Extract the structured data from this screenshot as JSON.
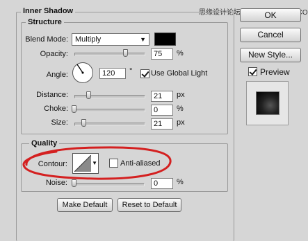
{
  "panel": {
    "title": "Inner Shadow"
  },
  "watermark": "思缘设计论坛 www.MISSYUAN.COM",
  "structure": {
    "title": "Structure",
    "blend_mode": {
      "label": "Blend Mode:",
      "value": "Multiply",
      "color": "#000000"
    },
    "opacity": {
      "label": "Opacity:",
      "value": "75",
      "unit": "%",
      "slider_fraction": 0.75
    },
    "angle": {
      "label": "Angle:",
      "value": "120",
      "unit": "°",
      "degrees": 120
    },
    "use_global_light": {
      "label": "Use Global Light",
      "checked": true
    },
    "distance": {
      "label": "Distance:",
      "value": "21",
      "unit": "px",
      "slider_fraction": 0.1
    },
    "choke": {
      "label": "Choke:",
      "value": "0",
      "unit": "%",
      "slider_fraction": 0.0
    },
    "size": {
      "label": "Size:",
      "value": "21",
      "unit": "px",
      "slider_fraction": 0.1
    }
  },
  "quality": {
    "title": "Quality",
    "contour": {
      "label": "Contour:"
    },
    "anti_aliased": {
      "label": "Anti-aliased",
      "checked": false
    },
    "noise": {
      "label": "Noise:",
      "value": "0",
      "unit": "%",
      "slider_fraction": 0.0
    }
  },
  "buttons": {
    "make_default": "Make Default",
    "reset_default": "Reset to Default",
    "ok": "OK",
    "cancel": "Cancel",
    "new_style": "New Style...",
    "preview": {
      "label": "Preview",
      "checked": true
    }
  },
  "colors": {
    "annotation": "#d42020"
  }
}
